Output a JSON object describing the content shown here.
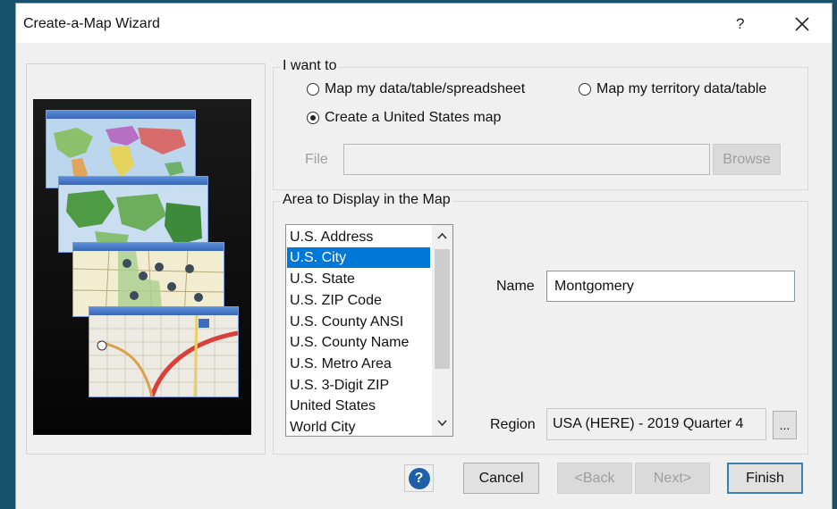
{
  "window": {
    "title": "Create-a-Map Wizard",
    "help_glyph": "?",
    "close_icon": "close-icon"
  },
  "intent_group": {
    "label": "I want to",
    "options": [
      {
        "label": "Map my data/table/spreadsheet",
        "selected": false
      },
      {
        "label": "Map my territory data/table",
        "selected": false
      },
      {
        "label": "Create a United States map",
        "selected": true
      }
    ],
    "file_label": "File",
    "file_value": "",
    "browse_label": "Browse"
  },
  "area_group": {
    "label": "Area to Display in the Map",
    "items": [
      "U.S. Address",
      "U.S. City",
      "U.S. State",
      "U.S. ZIP Code",
      "U.S. County ANSI",
      "U.S. County Name",
      "U.S. Metro Area",
      "U.S. 3-Digit ZIP",
      "United States",
      "World City"
    ],
    "selected_item": "U.S. City",
    "name_label": "Name",
    "name_value": "Montgomery",
    "region_label": "Region",
    "region_value": "USA (HERE) - 2019 Quarter 4",
    "region_browse": "..."
  },
  "footer": {
    "help_glyph": "?",
    "cancel": "Cancel",
    "back": "<Back",
    "next": "Next>",
    "finish": "Finish"
  },
  "colors": {
    "selection": "#0078d7",
    "help_blue": "#1e5fa8",
    "desktop": "#17506b"
  }
}
